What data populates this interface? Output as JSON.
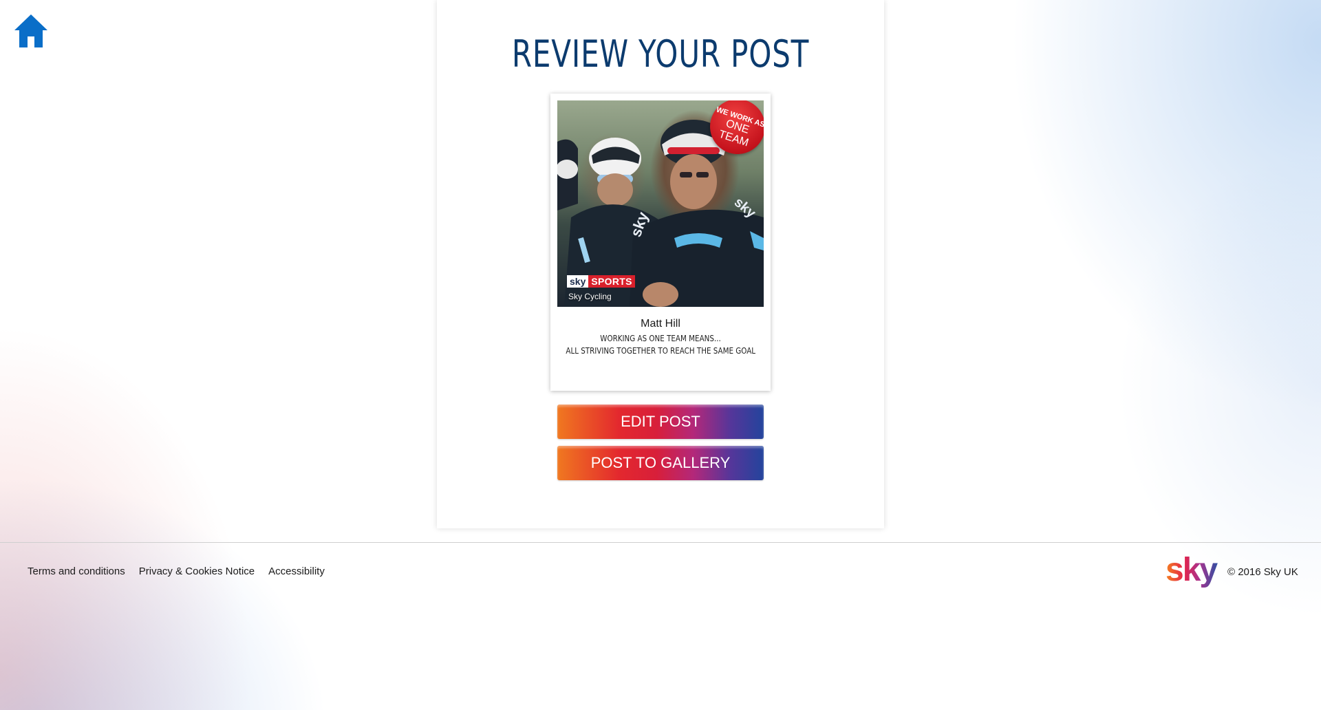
{
  "home": {
    "icon": "home-icon",
    "color": "#0a6ec8"
  },
  "page": {
    "title": "REVIEW YOUR POST"
  },
  "post": {
    "badge": {
      "line1": "WE WORK AS",
      "line2": "ONE TEAM"
    },
    "logo": {
      "sky": "sky",
      "sports": "SPORTS"
    },
    "caption": "Sky Cycling",
    "author": "Matt Hill",
    "message_line1": "WORKING AS ONE TEAM MEANS...",
    "message_line2": "ALL STRIVING TOGETHER TO REACH THE SAME GOAL"
  },
  "actions": {
    "edit_label": "EDIT POST",
    "gallery_label": "POST TO GALLERY"
  },
  "footer": {
    "links": [
      "Terms and conditions",
      "Privacy & Cookies Notice",
      "Accessibility"
    ],
    "copyright": "© 2016 Sky UK",
    "logo_text": "sky"
  },
  "colors": {
    "title": "#0c3b6e",
    "button_gradient": [
      "#f07820",
      "#e3282e",
      "#b3287a",
      "#23449c"
    ]
  }
}
